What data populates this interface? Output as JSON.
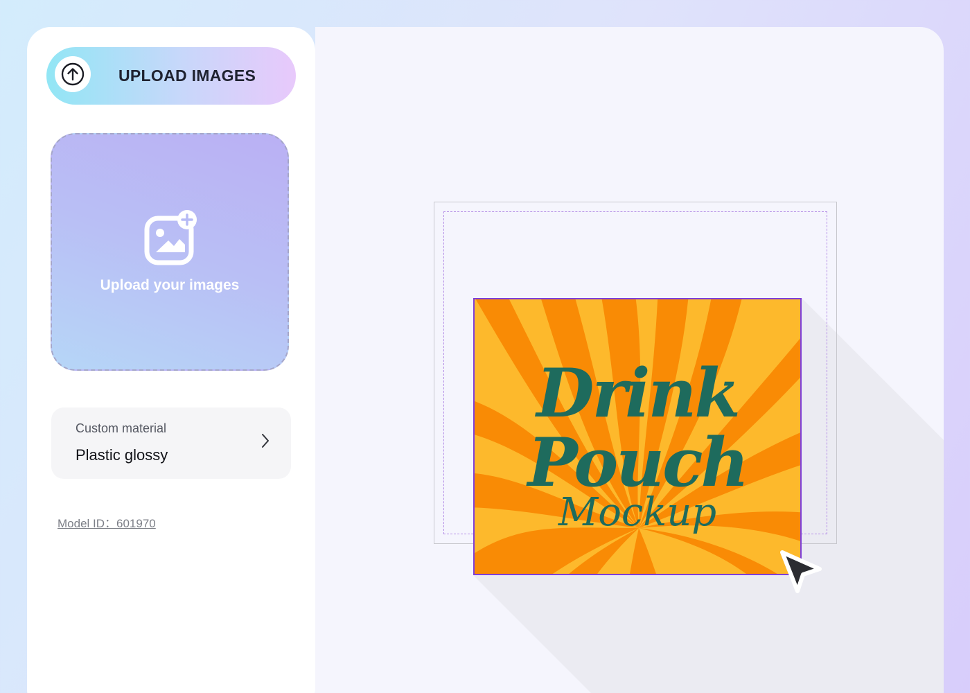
{
  "left_panel": {
    "upload_button": {
      "label": "UPLOAD IMAGES",
      "icon": "arrow-up-circle-icon"
    },
    "dropzone": {
      "text": "Upload your images",
      "icon": "image-add-icon"
    },
    "material": {
      "label": "Custom material",
      "value": "Plastic glossy",
      "icon": "chevron-right-icon"
    },
    "model_id": "Model ID：601970"
  },
  "canvas": {
    "artwork": {
      "line1": "Drink",
      "line2": "Pouch",
      "line3": "Mockup"
    },
    "cursor_icon": "pointer-arrow-icon"
  },
  "colors": {
    "accent_cyan": "#92e6f5",
    "accent_lilac": "#e8c9fb",
    "selection": "#7e3fd8",
    "art_orange": "#f98b05",
    "art_yellow": "#fdb92c",
    "art_text": "#1e6b5d"
  }
}
